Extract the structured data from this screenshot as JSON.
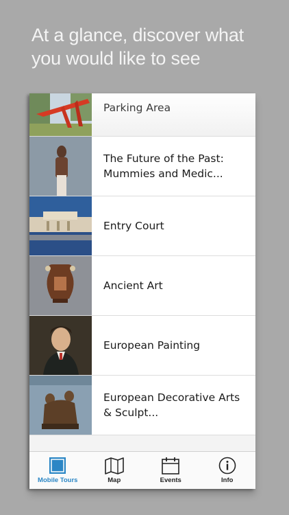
{
  "headline": "At a glance, discover what you would like to see",
  "tours": [
    {
      "label": "Parking Area",
      "thumb": "sculpture-photo"
    },
    {
      "label": "The Future of the Past: Mummies and Medic...",
      "thumb": "mummy-photo"
    },
    {
      "label": "Entry Court",
      "thumb": "building-photo"
    },
    {
      "label": "Ancient Art",
      "thumb": "vase-photo"
    },
    {
      "label": "European Painting",
      "thumb": "portrait-photo"
    },
    {
      "label": "European Decorative Arts & Sculpt...",
      "thumb": "sculpture-group-photo"
    }
  ],
  "tabs": [
    {
      "label": "Mobile Tours",
      "icon": "stamp-icon",
      "active": true
    },
    {
      "label": "Map",
      "icon": "map-icon",
      "active": false
    },
    {
      "label": "Events",
      "icon": "calendar-icon",
      "active": false
    },
    {
      "label": "Info",
      "icon": "info-icon",
      "active": false
    }
  ],
  "colors": {
    "background": "#a9a9a9",
    "accent": "#2b86c5"
  }
}
